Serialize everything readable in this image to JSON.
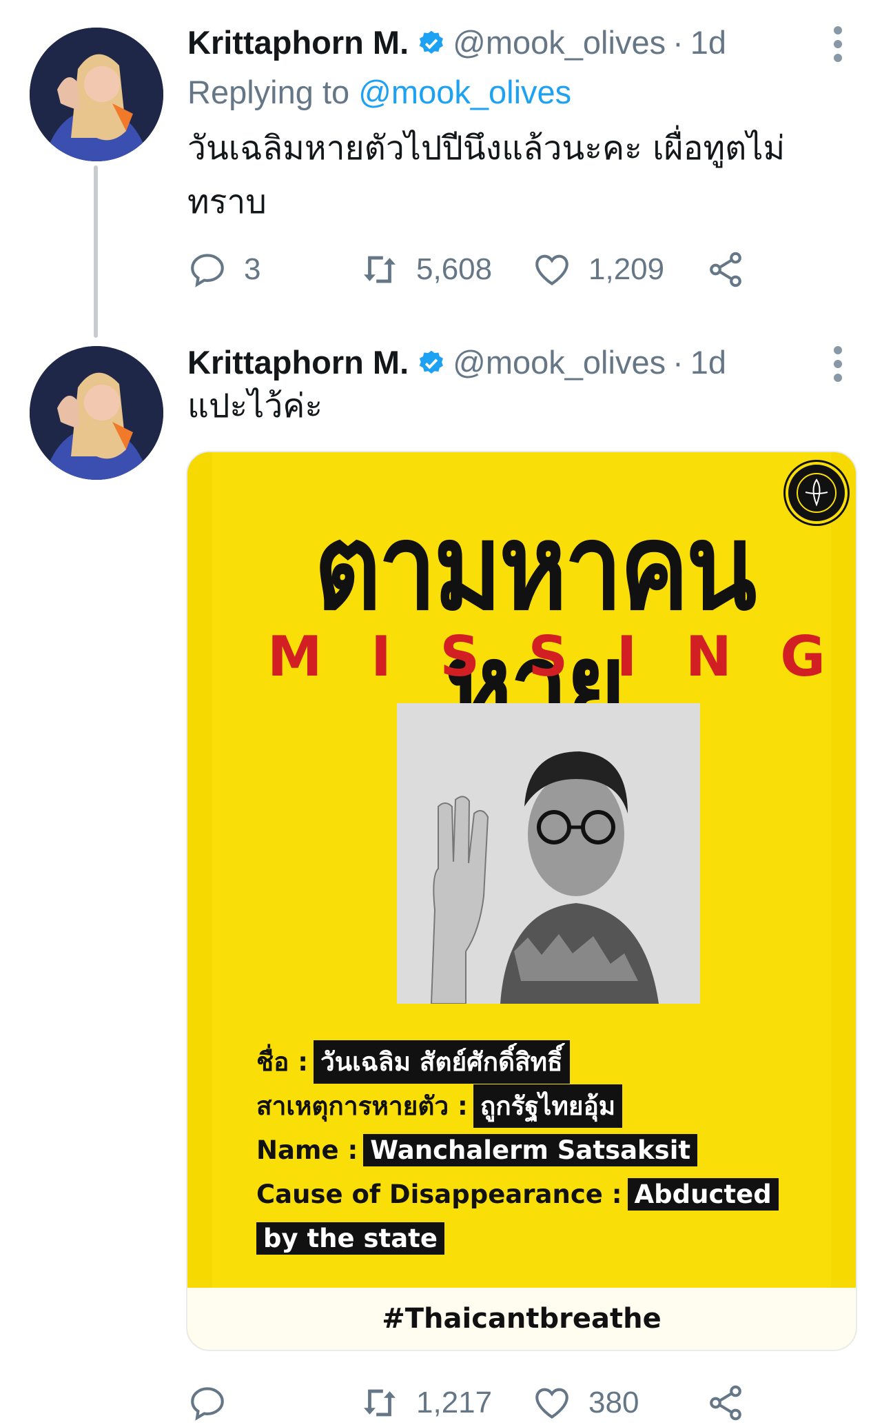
{
  "tweets": [
    {
      "name": "Krittaphorn M.",
      "handle": "@mook_olives",
      "separator": "·",
      "time": "1d",
      "replying_prefix": "Replying to",
      "replying_to": "@mook_olives",
      "text": "วันเฉลิมหายตัวไปปีนึงแล้วนะคะ เผื่อทูตไม่ทราบ",
      "replies": "3",
      "retweets": "5,608",
      "likes": "1,209"
    },
    {
      "name": "Krittaphorn M.",
      "handle": "@mook_olives",
      "separator": "·",
      "time": "1d",
      "text": "แปะไว้ค่ะ",
      "replies": "",
      "retweets": "1,217",
      "likes": "380",
      "poster": {
        "title_th": "ตามหาคนหาย",
        "missing_letters": [
          "M",
          "I",
          "S",
          "S",
          "I",
          "N",
          "G"
        ],
        "rows": [
          {
            "label": "ชื่อ :",
            "value": "วันเฉลิม สัตย์ศักดิ์สิทธิ์"
          },
          {
            "label": "สาเหตุการหายตัว :",
            "value": "ถูกรัฐไทยอุ้ม"
          },
          {
            "label": "Name :",
            "value": "Wanchalerm Satsaksit"
          },
          {
            "label": "Cause of Disappearance :",
            "value": "Abducted"
          },
          {
            "label": "",
            "value": "by the state"
          }
        ],
        "hashtag": "#Thaicantbreathe"
      }
    }
  ],
  "icons": [
    "more-vertical-icon",
    "verified-badge-icon",
    "reply-icon",
    "retweet-icon",
    "like-icon",
    "share-icon"
  ],
  "colors": {
    "link": "#1da1f2",
    "muted": "#657786",
    "poster_yellow": "#fade07",
    "missing_red": "#d21f24"
  }
}
